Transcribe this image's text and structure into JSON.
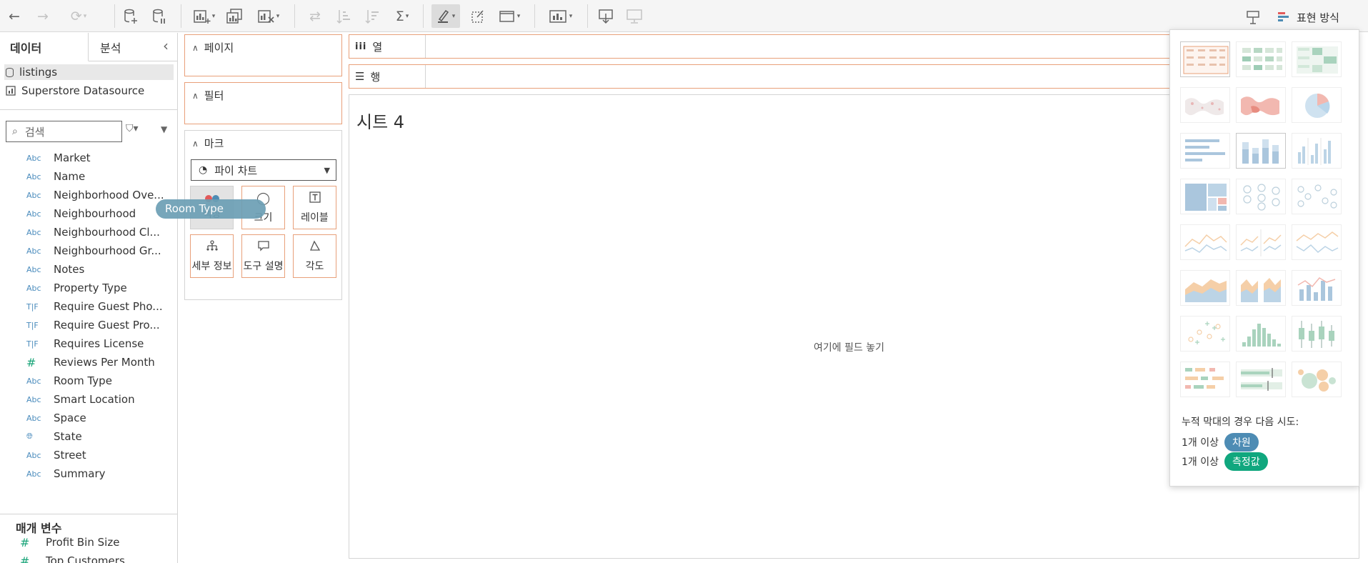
{
  "toolbar": {
    "showme_label": "표현 방식"
  },
  "pane": {
    "tab_data": "데이터",
    "tab_analysis": "분석",
    "sources": [
      "listings",
      "Superstore Datasource"
    ],
    "search_placeholder": "검색",
    "fields": [
      {
        "type": "Abc",
        "name": "Market"
      },
      {
        "type": "Abc",
        "name": "Name"
      },
      {
        "type": "Abc",
        "name": "Neighborhood Ove..."
      },
      {
        "type": "Abc",
        "name": "Neighbourhood"
      },
      {
        "type": "Abc",
        "name": "Neighbourhood Cl..."
      },
      {
        "type": "Abc",
        "name": "Neighbourhood Gr..."
      },
      {
        "type": "Abc",
        "name": "Notes"
      },
      {
        "type": "Abc",
        "name": "Property Type"
      },
      {
        "type": "T|F",
        "name": "Require Guest Pho..."
      },
      {
        "type": "T|F",
        "name": "Require Guest Pro..."
      },
      {
        "type": "T|F",
        "name": "Requires License"
      },
      {
        "type": "#",
        "name": "Reviews Per Month"
      },
      {
        "type": "Abc",
        "name": "Room Type"
      },
      {
        "type": "Abc",
        "name": "Smart Location"
      },
      {
        "type": "Abc",
        "name": "Space"
      },
      {
        "type": "globe",
        "name": "State"
      },
      {
        "type": "Abc",
        "name": "Street"
      },
      {
        "type": "Abc",
        "name": "Summary"
      }
    ],
    "params_title": "매개 변수",
    "params": [
      {
        "type": "#",
        "name": "Profit Bin Size"
      },
      {
        "type": "#",
        "name": "Top Customers"
      }
    ]
  },
  "cards": {
    "pages": "페이지",
    "filters": "필터",
    "marks": "마크",
    "mark_type": "파이 차트",
    "buttons": {
      "color": "색상",
      "size": "크기",
      "label": "레이블",
      "detail": "세부 정보",
      "tooltip": "도구 설명",
      "angle": "각도"
    }
  },
  "drag_pill": "Room Type",
  "shelves": {
    "columns": "열",
    "rows": "행"
  },
  "canvas": {
    "sheet_title": "시트 4",
    "drop_hint": "여기에 필드 놓기"
  },
  "showme": {
    "hint": "누적 막대의 경우 다음 시도:",
    "req_dim_prefix": "1개 이상",
    "req_dim": "차원",
    "req_meas_prefix": "1개 이상",
    "req_meas": "측정값"
  },
  "colors": {
    "accent_orange": "#e8a07a",
    "dimension_blue": "#4e8cb4",
    "measure_green": "#10a77e"
  }
}
